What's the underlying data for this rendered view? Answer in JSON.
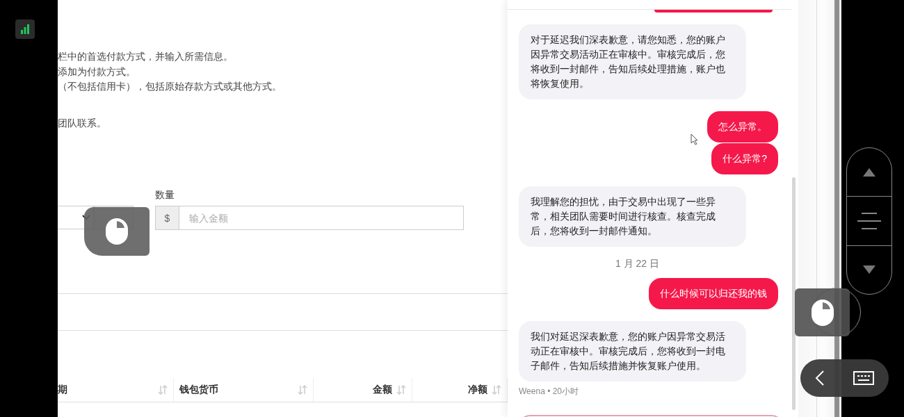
{
  "page": {
    "instructions": [
      "栏中的首选付款方式，并输入所需信息。",
      "添加为付款方式。",
      "（不包括信用卡），包括原始存款方式或其他方式。",
      "团队联系。"
    ],
    "form": {
      "amount_label": "数量",
      "amount_prefix": "$",
      "amount_placeholder": "输入金额"
    },
    "table": {
      "columns": [
        "期",
        "钱包货币",
        "金额",
        "净额"
      ]
    }
  },
  "chat": {
    "messages": [
      {
        "kind": "agent",
        "text": "对于延迟我们深表歉意，请您知悉，您的账户因异常交易活动正在审核中。审核完成后，您将收到一封邮件，告知后续处理措施，账户也将恢复使用。"
      },
      {
        "kind": "user",
        "text": "怎么异常。"
      },
      {
        "kind": "user",
        "text": "什么异常?"
      },
      {
        "kind": "agent",
        "text": "我理解您的担忧，由于交易中出现了一些异常，相关团队需要时间进行核查。核查完成后，您将收到一封邮件通知。"
      },
      {
        "kind": "date",
        "text": "1 月 22 日"
      },
      {
        "kind": "user",
        "text": "什么时候可以归还我的钱"
      },
      {
        "kind": "agent",
        "text": "我们对延迟深表歉意，您的账户因异常交易活动正在审核中。审核完成后，您将收到一封电子邮件，告知后续措施并恢复账户使用。"
      }
    ],
    "meta": "Weena • 20小时"
  }
}
